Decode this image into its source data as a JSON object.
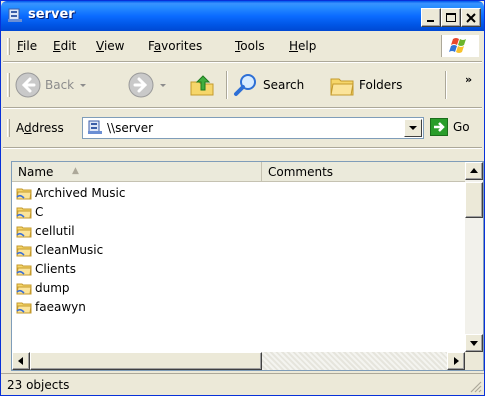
{
  "window": {
    "title": "server"
  },
  "menu": {
    "items": [
      {
        "pre": "",
        "u": "F",
        "post": "ile"
      },
      {
        "pre": "",
        "u": "E",
        "post": "dit"
      },
      {
        "pre": "",
        "u": "V",
        "post": "iew"
      },
      {
        "pre": "F",
        "u": "a",
        "post": "vorites"
      },
      {
        "pre": "",
        "u": "T",
        "post": "ools"
      },
      {
        "pre": "",
        "u": "H",
        "post": "elp"
      }
    ]
  },
  "toolbar": {
    "back_label": "Back",
    "search_label": "Search",
    "folders_label": "Folders",
    "more_label": "»"
  },
  "address": {
    "label_pre": "A",
    "label_u": "d",
    "label_post": "dress",
    "value": "\\\\server",
    "go_label": "Go"
  },
  "list": {
    "columns": [
      "Name",
      "Comments"
    ],
    "items": [
      "Archived Music",
      "C",
      "cellutil",
      "CleanMusic",
      "Clients",
      "dump",
      "faeawyn"
    ]
  },
  "status": {
    "text": "23 objects"
  },
  "colors": {
    "titlebar": "#0058ee",
    "window_bg": "#ece9d8",
    "go_green": "#2a9d2a"
  }
}
